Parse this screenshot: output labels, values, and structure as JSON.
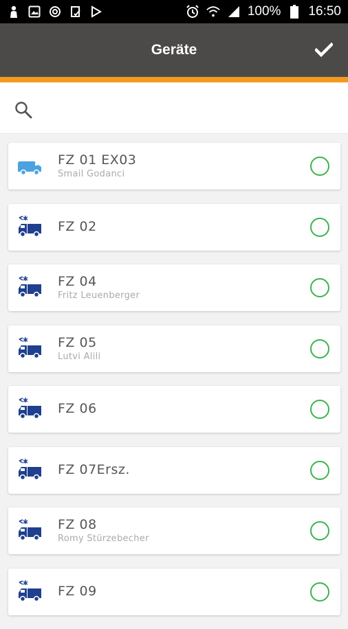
{
  "status_bar": {
    "battery_percent": "100%",
    "time": "16:50",
    "left_icons": [
      "person-icon",
      "image-icon",
      "sync-icon",
      "clipboard-icon",
      "play-icon"
    ],
    "right_icons": [
      "alarm-icon",
      "wifi-icon",
      "signal-icon",
      "battery-icon"
    ]
  },
  "app_bar": {
    "title": "Geräte",
    "confirm_icon": "checkmark-icon",
    "background": "#4b4a48",
    "accent": "#f39a1e"
  },
  "search": {
    "icon": "search-icon",
    "value": "",
    "placeholder": ""
  },
  "devices": [
    {
      "name": "FZ 01 EX03",
      "driver": "Smail Godanci",
      "icon": "van-icon",
      "icon_color": "#4aa3df"
    },
    {
      "name": "FZ 02",
      "driver": "",
      "icon": "refrigerated-truck-icon",
      "icon_color": "#1f3f8f"
    },
    {
      "name": "FZ 04",
      "driver": "Fritz Leuenberger",
      "icon": "refrigerated-truck-icon",
      "icon_color": "#1f3f8f"
    },
    {
      "name": "FZ 05",
      "driver": "Lutvi Alili",
      "icon": "refrigerated-truck-icon",
      "icon_color": "#1f3f8f"
    },
    {
      "name": "FZ 06",
      "driver": "",
      "icon": "refrigerated-truck-icon",
      "icon_color": "#1f3f8f"
    },
    {
      "name": "FZ 07Ersz.",
      "driver": "",
      "icon": "refrigerated-van-icon",
      "icon_color": "#1f3f8f"
    },
    {
      "name": "FZ 08",
      "driver": "Romy Stürzebecher",
      "icon": "refrigerated-truck-icon",
      "icon_color": "#1f3f8f"
    },
    {
      "name": "FZ 09",
      "driver": "",
      "icon": "refrigerated-truck-icon",
      "icon_color": "#1f3f8f"
    }
  ],
  "selection_color": "#39b54a"
}
